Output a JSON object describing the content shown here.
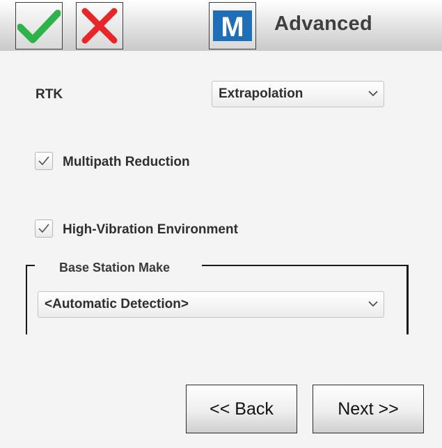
{
  "header": {
    "title": "Advanced",
    "ok_icon": "checkmark-icon",
    "cancel_icon": "x-icon",
    "mode_icon": "m-logo-icon",
    "mode_letter": "M",
    "colors": {
      "check": "#2db34a",
      "cross": "#e8262a",
      "logo": "#1f6fb8"
    }
  },
  "rtk": {
    "label": "RTK",
    "value": "Extrapolation"
  },
  "options": {
    "multipath": {
      "label": "Multipath Reduction",
      "checked": true
    },
    "vibration": {
      "label": "High-Vibration Environment",
      "checked": true
    }
  },
  "base_station": {
    "legend": "Base Station Make",
    "value": "<Automatic Detection>"
  },
  "nav": {
    "back_label": "<< Back",
    "next_label": "Next >>"
  }
}
